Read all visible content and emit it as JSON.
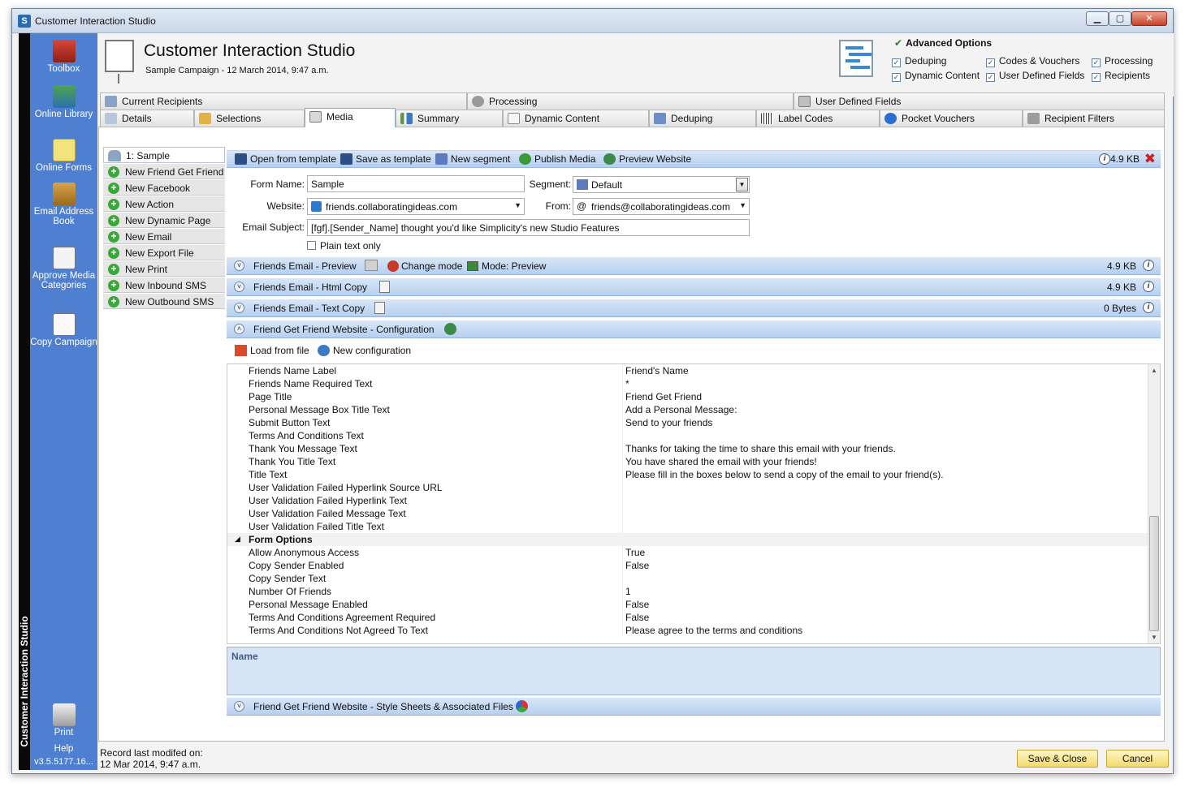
{
  "window": {
    "title": "Customer Interaction Studio",
    "app_letter": "S",
    "minimize": "▁",
    "maximize": "▢",
    "close": "✕"
  },
  "sidebar": {
    "vertical_title": "Customer Interaction Studio",
    "items": [
      {
        "label": "Toolbox"
      },
      {
        "label": "Online Library"
      },
      {
        "label": "Online Forms"
      },
      {
        "label": "Email Address Book"
      },
      {
        "label": "Approve Media Categories"
      },
      {
        "label": "Copy Campaign"
      },
      {
        "label": "Print"
      },
      {
        "label": "Help"
      }
    ],
    "version": "v3.5.5177.16..."
  },
  "header": {
    "title": "Customer Interaction Studio",
    "subtitle": "Sample Campaign - 12 March 2014, 9:47 a.m.",
    "advanced_options_label": "Advanced Options",
    "options": [
      {
        "label": "Deduping",
        "checked": true
      },
      {
        "label": "Codes & Vouchers",
        "checked": true
      },
      {
        "label": "Processing",
        "checked": true
      },
      {
        "label": "Dynamic Content",
        "checked": true
      },
      {
        "label": "User Defined Fields",
        "checked": true
      },
      {
        "label": "Recipients",
        "checked": true
      }
    ]
  },
  "tabs_top": [
    {
      "label": "Current Recipients"
    },
    {
      "label": "Processing"
    },
    {
      "label": "User Defined Fields"
    }
  ],
  "tabs_bottom": [
    {
      "label": "Details"
    },
    {
      "label": "Selections"
    },
    {
      "label": "Media",
      "active": true
    },
    {
      "label": "Summary"
    },
    {
      "label": "Dynamic Content"
    },
    {
      "label": "Deduping"
    },
    {
      "label": "Label Codes"
    },
    {
      "label": "Pocket Vouchers"
    },
    {
      "label": "Recipient Filters"
    }
  ],
  "media_list": [
    {
      "label": "1: Sample",
      "selected": true
    },
    {
      "label": "New Friend Get Friend"
    },
    {
      "label": "New Facebook"
    },
    {
      "label": "New Action"
    },
    {
      "label": "New Dynamic Page"
    },
    {
      "label": "New Email"
    },
    {
      "label": "New Export File"
    },
    {
      "label": "New Print"
    },
    {
      "label": "New Inbound SMS"
    },
    {
      "label": "New Outbound SMS"
    }
  ],
  "toolbar": {
    "open_template": "Open from template",
    "save_template": "Save as template",
    "new_segment": "New segment",
    "publish_media": "Publish Media",
    "preview_website": "Preview Website",
    "size": "4.9 KB",
    "info": "i",
    "close": "✖"
  },
  "form": {
    "form_name_label": "Form Name:",
    "form_name_value": "Sample",
    "segment_label": "Segment:",
    "segment_value": "Default",
    "website_label": "Website:",
    "website_value": "friends.collaboratingideas.com",
    "from_label": "From:",
    "from_value": "friends@collaboratingideas.com",
    "subject_label": "Email Subject:",
    "subject_value": "[fgf].[Sender_Name] thought you'd like Simplicity's new Studio Features",
    "plain_text_label": "Plain text only",
    "plain_text_checked": false
  },
  "sections": [
    {
      "title": "Friends Email - Preview",
      "size": "4.9 KB",
      "change_mode": "Change mode",
      "mode": "Mode: Preview"
    },
    {
      "title": "Friends Email - Html Copy",
      "size": "4.9 KB"
    },
    {
      "title": "Friends Email - Text Copy",
      "size": "0 Bytes"
    },
    {
      "title": "Friend Get Friend Website - Configuration"
    }
  ],
  "config_toolbar": {
    "load_file": "Load from file",
    "new_config": "New configuration"
  },
  "properties": [
    {
      "key": "Friends Name Label",
      "value": "Friend's Name"
    },
    {
      "key": "Friends Name Required Text",
      "value": "*"
    },
    {
      "key": "Page Title",
      "value": "Friend Get Friend"
    },
    {
      "key": "Personal Message Box Title Text",
      "value": "Add a Personal Message:"
    },
    {
      "key": "Submit Button Text",
      "value": "Send to your friends"
    },
    {
      "key": "Terms And Conditions Text",
      "value": ""
    },
    {
      "key": "Thank You Message Text",
      "value": "Thanks for taking the time to share this email with your friends."
    },
    {
      "key": "Thank You Title Text",
      "value": "You have shared the email with your friends!"
    },
    {
      "key": "Title Text",
      "value": "Please fill in the boxes below to send a copy of the email to your friend(s)."
    },
    {
      "key": "User Validation Failed Hyperlink Source URL",
      "value": ""
    },
    {
      "key": "User Validation Failed Hyperlink Text",
      "value": ""
    },
    {
      "key": "User Validation Failed Message Text",
      "value": ""
    },
    {
      "key": "User Validation Failed Title Text",
      "value": ""
    }
  ],
  "form_options_label": "Form Options",
  "form_options": [
    {
      "key": "Allow Anonymous Access",
      "value": "True"
    },
    {
      "key": "Copy Sender Enabled",
      "value": "False"
    },
    {
      "key": "Copy Sender Text",
      "value": ""
    },
    {
      "key": "Number Of Friends",
      "value": "1"
    },
    {
      "key": "Personal Message Enabled",
      "value": "False"
    },
    {
      "key": "Terms And Conditions Agreement Required",
      "value": "False"
    },
    {
      "key": "Terms And Conditions Not Agreed To Text",
      "value": "Please agree to the terms and conditions"
    }
  ],
  "description": {
    "name": "Name"
  },
  "style_section": {
    "title": "Friend Get Friend Website - Style Sheets & Associated Files"
  },
  "footer": {
    "record_label": "Record last modifed on:",
    "record_date": "12 Mar 2014, 9:47 a.m.",
    "save_close": "Save & Close",
    "cancel": "Cancel"
  },
  "colors": {
    "sidebar": "#4f7fd0",
    "section_bar": "#c4d8f2",
    "accent_button": "#f2d96b"
  }
}
